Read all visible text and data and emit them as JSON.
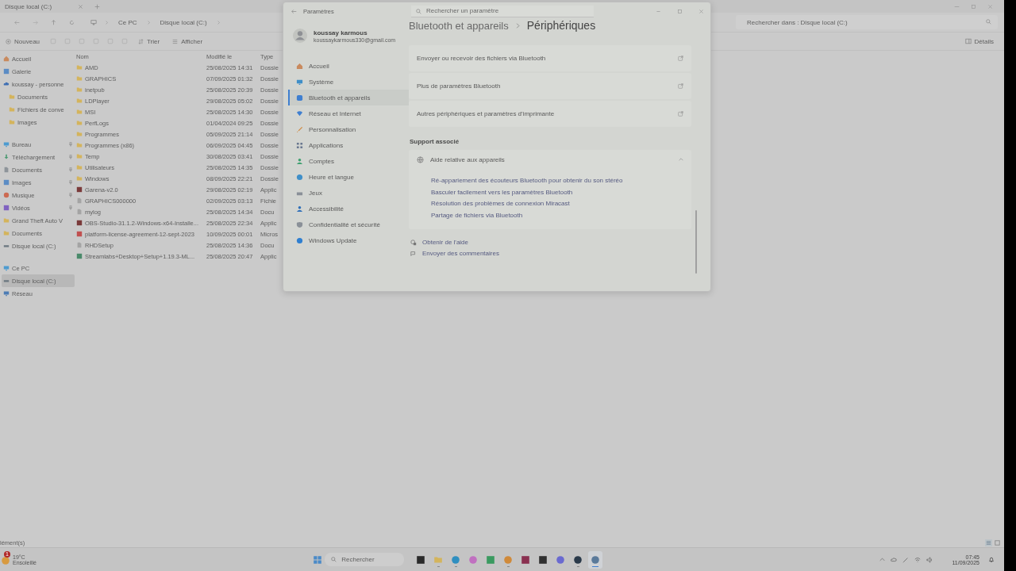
{
  "explorer": {
    "tab_title": "Disque local (C:)",
    "breadcrumb": [
      "Ce PC",
      "Disque local (C:)"
    ],
    "search": {
      "placeholder": "Rechercher dans : Disque local (C:)"
    },
    "toolbar": {
      "new": "Nouveau",
      "sort": "Trier",
      "view": "Afficher",
      "details": "Détails"
    },
    "nav_groups": [
      [
        {
          "label": "Accueil",
          "kind": "home",
          "pinned": false,
          "selected": false
        },
        {
          "label": "Galerie",
          "kind": "gallery",
          "pinned": false,
          "selected": false
        },
        {
          "label": "koussay - personne",
          "kind": "cloud",
          "pinned": false,
          "selected": false,
          "children": [
            {
              "label": "Documents",
              "kind": "folder",
              "pinned": false,
              "selected": false
            },
            {
              "label": "Fichiers de conve",
              "kind": "folder",
              "pinned": false,
              "selected": false
            },
            {
              "label": "Images",
              "kind": "folder",
              "pinned": false,
              "selected": false
            }
          ]
        }
      ],
      [
        {
          "label": "Bureau",
          "kind": "desktop",
          "pinned": true,
          "selected": false
        },
        {
          "label": "Téléchargement",
          "kind": "download",
          "pinned": true,
          "selected": false
        },
        {
          "label": "Documents",
          "kind": "docs",
          "pinned": true,
          "selected": false
        },
        {
          "label": "Images",
          "kind": "images",
          "pinned": true,
          "selected": false
        },
        {
          "label": "Musique",
          "kind": "music",
          "pinned": true,
          "selected": false
        },
        {
          "label": "Vidéos",
          "kind": "video",
          "pinned": true,
          "selected": false
        },
        {
          "label": "Grand Theft Auto V",
          "kind": "folder",
          "pinned": false,
          "selected": false
        },
        {
          "label": "Documents",
          "kind": "folder",
          "pinned": false,
          "selected": false
        },
        {
          "label": "Disque local (C:)",
          "kind": "drive",
          "pinned": false,
          "selected": false
        }
      ],
      [
        {
          "label": "Ce PC",
          "kind": "pc",
          "pinned": false,
          "selected": false
        },
        {
          "label": "Disque local (C:)",
          "kind": "drive",
          "pinned": false,
          "selected": true
        },
        {
          "label": "Réseau",
          "kind": "network",
          "pinned": false,
          "selected": false
        }
      ]
    ],
    "columns": [
      "Nom",
      "Modifié le",
      "Type"
    ],
    "rows": [
      {
        "name": "AMD",
        "modified": "25/08/2025 14:31",
        "type": "Dossie",
        "kind": "folder"
      },
      {
        "name": "GRAPHICS",
        "modified": "07/09/2025 01:32",
        "type": "Dossie",
        "kind": "folder"
      },
      {
        "name": "inetpub",
        "modified": "25/08/2025 20:39",
        "type": "Dossie",
        "kind": "folder"
      },
      {
        "name": "LDPlayer",
        "modified": "29/08/2025 05:02",
        "type": "Dossie",
        "kind": "folder"
      },
      {
        "name": "MSI",
        "modified": "25/08/2025 14:30",
        "type": "Dossie",
        "kind": "folder"
      },
      {
        "name": "PerfLogs",
        "modified": "01/04/2024 09:25",
        "type": "Dossie",
        "kind": "folder"
      },
      {
        "name": "Programmes",
        "modified": "05/09/2025 21:14",
        "type": "Dossie",
        "kind": "folder"
      },
      {
        "name": "Programmes (x86)",
        "modified": "06/09/2025 04:45",
        "type": "Dossie",
        "kind": "folder"
      },
      {
        "name": "Temp",
        "modified": "30/08/2025 03:41",
        "type": "Dossie",
        "kind": "folder"
      },
      {
        "name": "Utilisateurs",
        "modified": "25/08/2025 14:35",
        "type": "Dossie",
        "kind": "folder"
      },
      {
        "name": "Windows",
        "modified": "08/09/2025 22:21",
        "type": "Dossie",
        "kind": "folder"
      },
      {
        "name": "Garena-v2.0",
        "modified": "29/08/2025 02:19",
        "type": "Applic",
        "kind": "app"
      },
      {
        "name": "GRAPHICS000000",
        "modified": "02/09/2025 03:13",
        "type": "Fichie",
        "kind": "file"
      },
      {
        "name": "mylog",
        "modified": "25/08/2025 14:34",
        "type": "Docu",
        "kind": "file"
      },
      {
        "name": "OBS-Studio-31.1.2-Windows-x64-Installe...",
        "modified": "25/08/2025 22:34",
        "type": "Applic",
        "kind": "app"
      },
      {
        "name": "platform-license-agreement-12-sept-2023",
        "modified": "10/09/2025 00:01",
        "type": "Micros",
        "kind": "pdf"
      },
      {
        "name": "RHDSetup",
        "modified": "25/08/2025 14:36",
        "type": "Docu",
        "kind": "file"
      },
      {
        "name": "Streamlabs+Desktop+Setup+1.19.3-ML...",
        "modified": "25/08/2025 20:47",
        "type": "Applic",
        "kind": "setup"
      }
    ],
    "status": "lément(s)"
  },
  "settings": {
    "title": "Paramètres",
    "search": {
      "placeholder": "Rechercher un paramètre"
    },
    "user": {
      "name": "koussay karmous",
      "email": "koussaykarmous330@gmail.com"
    },
    "nav": [
      {
        "label": "Accueil",
        "kind": "home",
        "selected": false
      },
      {
        "label": "Système",
        "kind": "system",
        "selected": false
      },
      {
        "label": "Bluetooth et appareils",
        "kind": "bluetooth",
        "selected": true
      },
      {
        "label": "Réseau et Internet",
        "kind": "network",
        "selected": false
      },
      {
        "label": "Personnalisation",
        "kind": "personalization",
        "selected": false
      },
      {
        "label": "Applications",
        "kind": "apps",
        "selected": false
      },
      {
        "label": "Comptes",
        "kind": "accounts",
        "selected": false
      },
      {
        "label": "Heure et langue",
        "kind": "time",
        "selected": false
      },
      {
        "label": "Jeux",
        "kind": "games",
        "selected": false
      },
      {
        "label": "Accessibilité",
        "kind": "accessibility",
        "selected": false
      },
      {
        "label": "Confidentialité et sécurité",
        "kind": "privacy",
        "selected": false
      },
      {
        "label": "Windows Update",
        "kind": "update",
        "selected": false
      }
    ],
    "breadcrumb": [
      "Bluetooth et appareils",
      "Périphériques"
    ],
    "link_rows": [
      "Envoyer ou recevoir des fichiers via Bluetooth",
      "Plus de paramètres Bluetooth",
      "Autres périphériques et paramètres d'imprimante"
    ],
    "section": "Support associé",
    "expander": {
      "title": "Aide relative aux appareils",
      "expanded": true,
      "links": [
        "Ré-appariement des écouteurs Bluetooth pour obtenir du son stéréo",
        "Basculer facilement vers les paramètres Bluetooth",
        "Résolution des problèmes de connexion Miracast",
        "Partage de fichiers via Bluetooth"
      ]
    },
    "footer": [
      "Obtenir de l'aide",
      "Envoyer des commentaires"
    ]
  },
  "taskbar": {
    "weather": {
      "temp": "19°C",
      "condition": "Ensoleillé",
      "badge": "1"
    },
    "search": {
      "placeholder": "Rechercher"
    },
    "apps": [
      {
        "kind": "taskview",
        "running": false,
        "active": false
      },
      {
        "kind": "explorer",
        "running": true,
        "active": false
      },
      {
        "kind": "edge",
        "running": true,
        "active": false
      },
      {
        "kind": "copilot",
        "running": false,
        "active": false
      },
      {
        "kind": "terminal",
        "running": false,
        "active": false
      },
      {
        "kind": "chrome",
        "running": true,
        "active": false
      },
      {
        "kind": "game",
        "running": false,
        "active": false
      },
      {
        "kind": "dark",
        "running": false,
        "active": false
      },
      {
        "kind": "discord",
        "running": false,
        "active": false
      },
      {
        "kind": "steam",
        "running": true,
        "active": false
      },
      {
        "kind": "settings",
        "running": true,
        "active": true
      }
    ],
    "time": "07:45",
    "date": "11/09/2025"
  }
}
